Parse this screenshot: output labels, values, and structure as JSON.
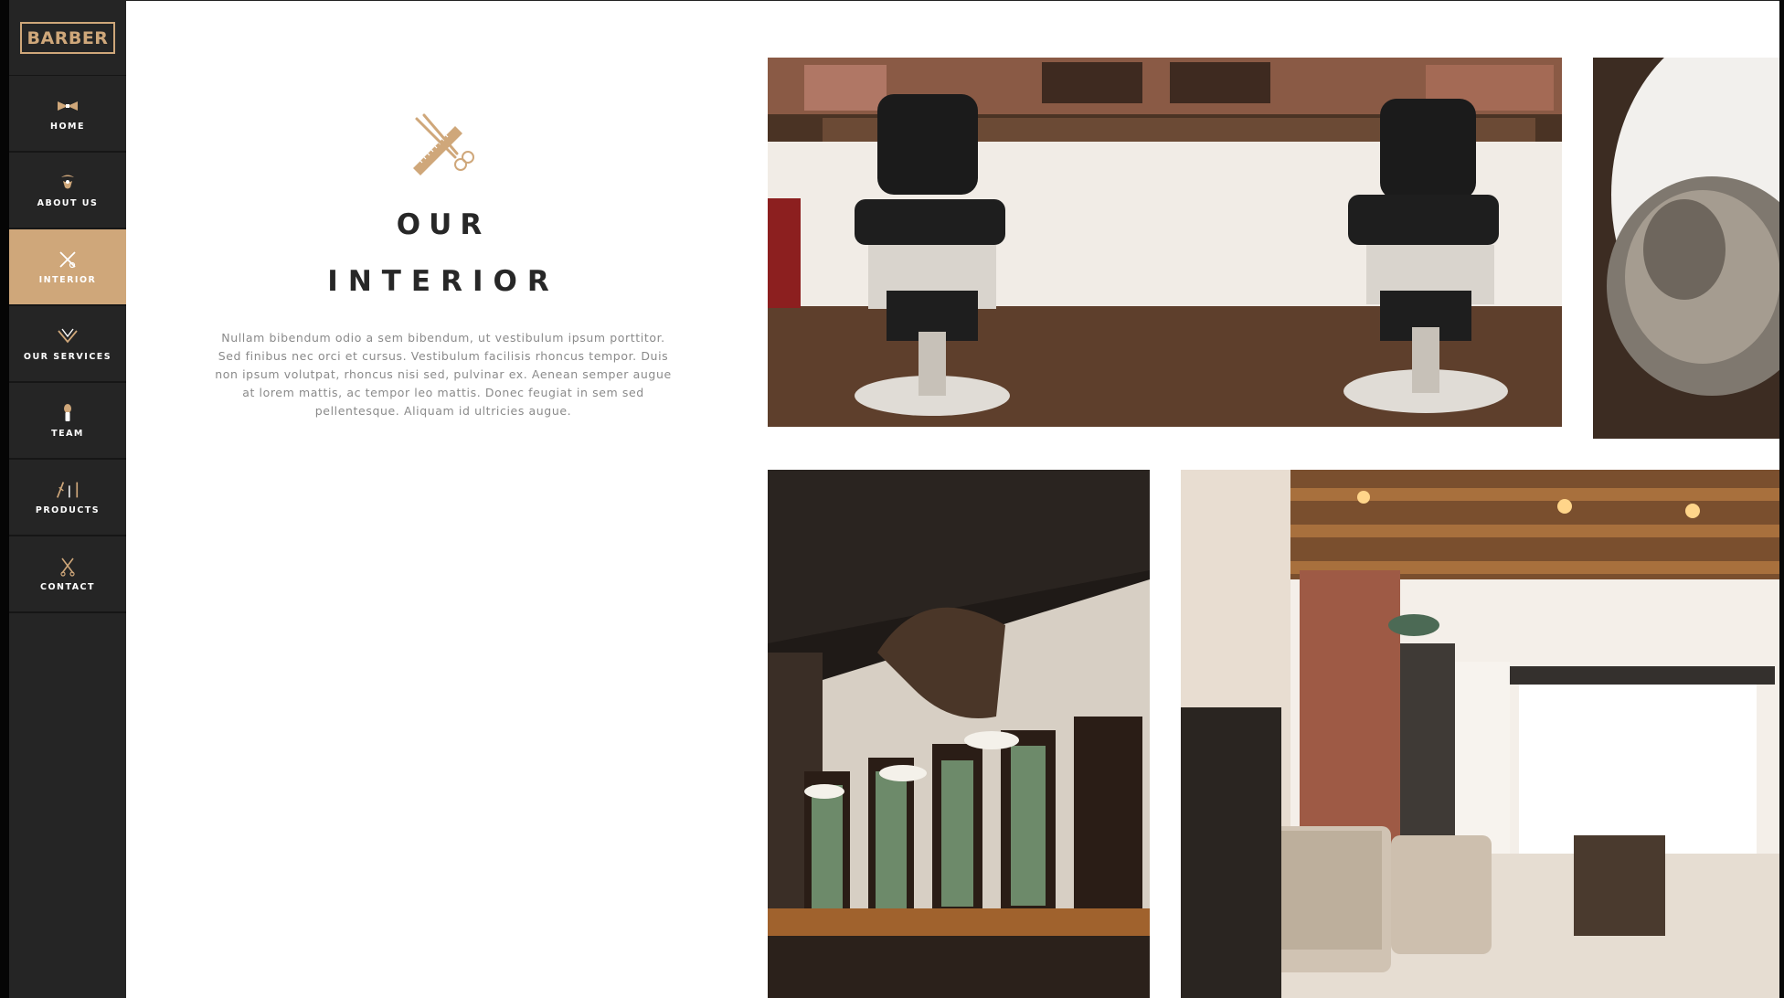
{
  "logo": {
    "text": "BARBER"
  },
  "nav": {
    "items": [
      {
        "label": "HOME",
        "icon": "bowtie-icon"
      },
      {
        "label": "ABOUT US",
        "icon": "mustache-icon"
      },
      {
        "label": "INTERIOR",
        "icon": "scissors-comb-icon",
        "active": true
      },
      {
        "label": "OUR SERVICES",
        "icon": "razor-icon"
      },
      {
        "label": "TEAM",
        "icon": "shaving-brush-icon"
      },
      {
        "label": "PRODUCTS",
        "icon": "tools-icon"
      },
      {
        "label": "CONTACT",
        "icon": "scissors-icon"
      }
    ]
  },
  "section": {
    "icon": "scissors-comb-icon",
    "title_line1": "OUR",
    "title_line2": "INTERIOR",
    "description": "Nullam bibendum odio a sem bibendum, ut vestibulum ipsum porttitor. Sed finibus nec orci et cursus. Vestibulum facilisis rhoncus tempor. Duis non ipsum volutpat, rhoncus nisi sed, pulvinar ex. Aenean semper augue at lorem mattis, ac tempor leo mattis. Donec feugiat in sem sed pellentesque. Aliquam id ultricies augue."
  },
  "gallery": [
    {
      "subject": "barber chairs photo"
    },
    {
      "subject": "shaving brush photo"
    },
    {
      "subject": "barbershop with moose head photo"
    },
    {
      "subject": "barbershop interior with skylight photo"
    }
  ],
  "colors": {
    "accent": "#cfa77a",
    "sidebar": "#252525",
    "heading": "#272727",
    "body_text": "#8a8a8a"
  }
}
